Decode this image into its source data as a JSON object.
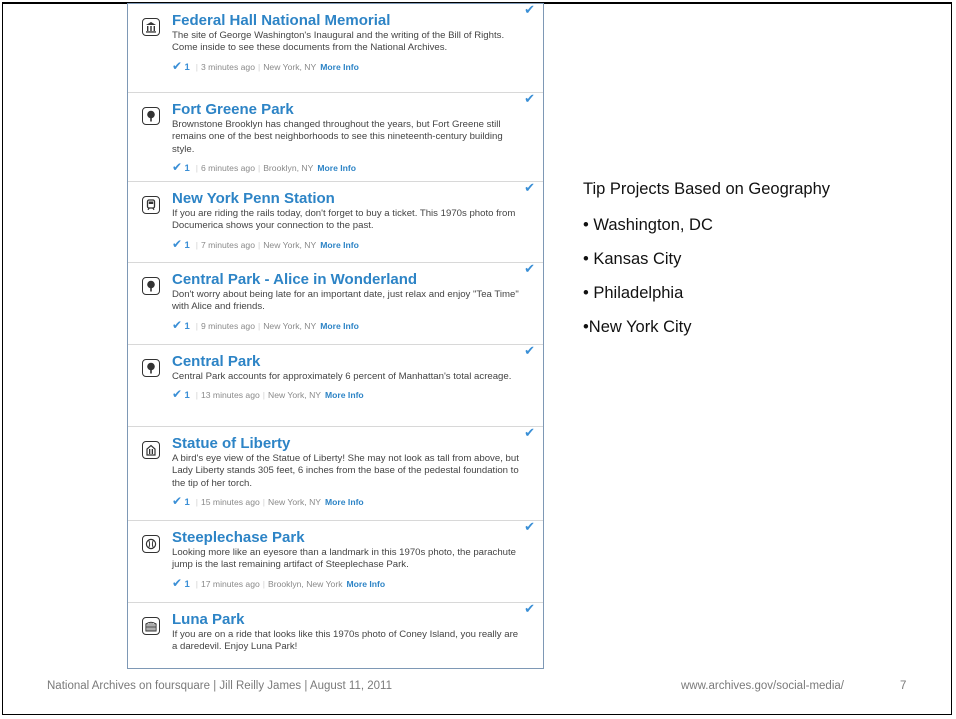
{
  "tips": [
    {
      "title": "Federal Hall National Memorial",
      "icon": "monument-icon",
      "desc": "The site of George Washington's Inaugural and the writing of the Bill of Rights. Come inside to see these documents from the National Archives.",
      "count": "1",
      "time": "3 minutes ago",
      "location": "New York, NY",
      "more": "More Info"
    },
    {
      "title": "Fort Greene Park",
      "icon": "tree-icon",
      "desc": "Brownstone Brooklyn has changed throughout the years, but Fort Greene still remains one of the best neighborhoods to see this nineteenth-century building style.",
      "count": "1",
      "time": "6 minutes ago",
      "location": "Brooklyn, NY",
      "more": "More Info"
    },
    {
      "title": "New York Penn Station",
      "icon": "train-icon",
      "desc": "If you are riding the rails today, don't forget to buy a ticket. This 1970s photo from Documerica shows your connection to the past.",
      "count": "1",
      "time": "7 minutes ago",
      "location": "New York, NY",
      "more": "More Info"
    },
    {
      "title": "Central Park - Alice in Wonderland",
      "icon": "tree-icon",
      "desc": "Don't worry about being late for an important date, just relax and enjoy \"Tea Time\" with Alice and friends.",
      "count": "1",
      "time": "9 minutes ago",
      "location": "New York, NY",
      "more": "More Info"
    },
    {
      "title": "Central Park",
      "icon": "tree-icon",
      "desc": "Central Park accounts for approximately 6 percent of Manhattan's total acreage.",
      "count": "1",
      "time": "13 minutes ago",
      "location": "New York, NY",
      "more": "More Info"
    },
    {
      "title": "Statue of Liberty",
      "icon": "building-icon",
      "desc": "A bird's eye view of the Statue of Liberty! She may not look as tall from above, but Lady Liberty stands 305 feet, 6 inches from the base of the pedestal foundation to the tip of her torch.",
      "count": "1",
      "time": "15 minutes ago",
      "location": "New York, NY",
      "more": "More Info"
    },
    {
      "title": "Steeplechase Park",
      "icon": "ball-icon",
      "desc": "Looking more like an eyesore than a landmark in this 1970s photo, the parachute jump is the last remaining artifact of Steeplechase Park.",
      "count": "1",
      "time": "17 minutes ago",
      "location": "Brooklyn, New York",
      "more": "More Info"
    },
    {
      "title": "Luna Park",
      "icon": "stadium-icon",
      "desc": "If you are on a ride that looks like this 1970s photo of Coney Island, you really are a daredevil. Enjoy Luna Park!",
      "count": "",
      "time": "",
      "location": "",
      "more": ""
    }
  ],
  "side": {
    "heading": "Tip Projects Based on Geography",
    "items": [
      "• Washington, DC",
      "• Kansas City",
      "• Philadelphia",
      "•New York City"
    ]
  },
  "footer": {
    "left": "National Archives on foursquare  |  Jill Reilly James  |  August 11, 2011",
    "url": "www.archives.gov/social-media/",
    "page": "7"
  },
  "colors": {
    "title": "#2d84c6",
    "check": "#3a8fd6",
    "border": "#7e98b5"
  }
}
